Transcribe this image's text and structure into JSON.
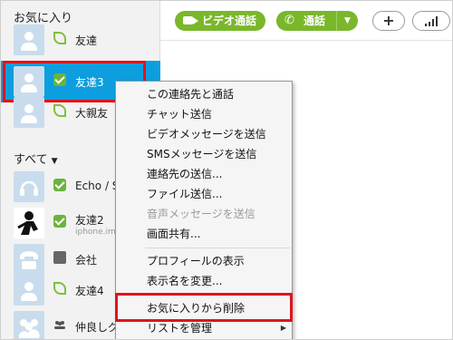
{
  "colors": {
    "accent_green": "#7ab72b",
    "selected_blue": "#0c9ede",
    "highlight_red": "#e0141b"
  },
  "sidebar": {
    "favorites_title": "お気に入り",
    "favorites": [
      {
        "name": "友達",
        "status": "leaf-status-icon",
        "avatar": "default-avatar"
      },
      {
        "name": "友達3",
        "status": "available-check-icon",
        "avatar": "default-avatar",
        "selected": true
      },
      {
        "name": "大親友",
        "status": "leaf-status-icon",
        "avatar": "default-avatar"
      }
    ],
    "all_title": "すべて",
    "all_caret": "▼",
    "all": [
      {
        "name": "Echo / Sou",
        "status": "available-check-icon",
        "avatar": "echo-headset-avatar"
      },
      {
        "name": "友達2",
        "sub": "iphone.im",
        "status": "available-check-icon",
        "avatar": "photo-avatar"
      },
      {
        "name": "会社",
        "status": "company-icon",
        "avatar": "phone-avatar"
      },
      {
        "name": "友達4",
        "status": "leaf-status-icon",
        "avatar": "default-avatar"
      },
      {
        "name": "仲良しグ",
        "status": "people-icon",
        "avatar": "group-avatar"
      }
    ]
  },
  "toolbar": {
    "video_label": "ビデオ通話",
    "call_label": "通話",
    "call_caret": "▼",
    "add_label": "+"
  },
  "menu": {
    "items": [
      {
        "label": "この連絡先と通話"
      },
      {
        "label": "チャット送信"
      },
      {
        "label": "ビデオメッセージを送信"
      },
      {
        "label": "SMSメッセージを送信"
      },
      {
        "label": "連絡先の送信..."
      },
      {
        "label": "ファイル送信..."
      },
      {
        "label": "音声メッセージを送信",
        "disabled": true
      },
      {
        "label": "画面共有..."
      },
      {
        "label": "プロフィールの表示"
      },
      {
        "label": "表示名を変更..."
      },
      {
        "label": "お気に入りから削除",
        "highlighted": true
      },
      {
        "label": "リストを管理",
        "submenu": true
      }
    ],
    "submenu_arrow": "▶"
  }
}
